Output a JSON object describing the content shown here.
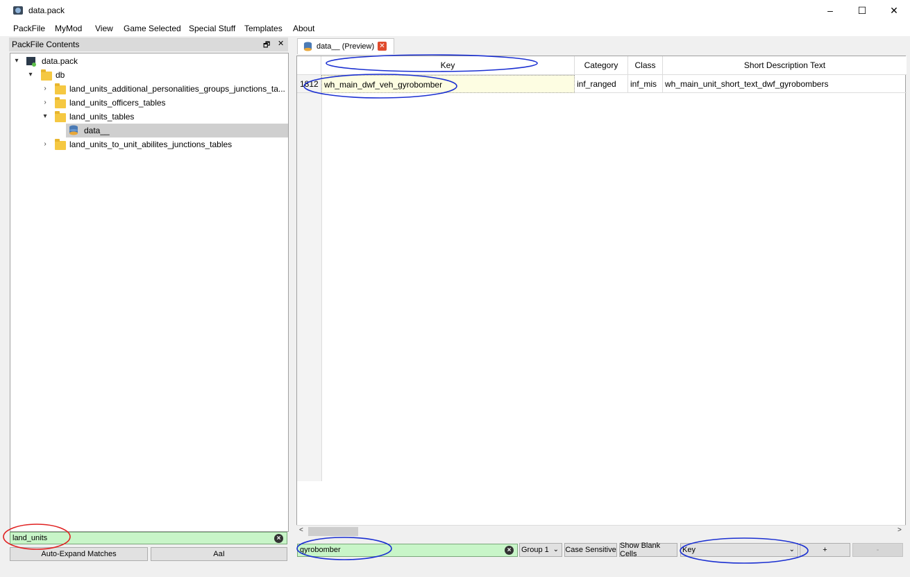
{
  "window": {
    "title": "data.pack",
    "minimize": "–",
    "maximize": "☐",
    "close": "✕"
  },
  "menu": {
    "items": [
      "PackFile",
      "MyMod",
      "View",
      "Game Selected",
      "Special Stuff",
      "Templates",
      "About"
    ]
  },
  "packfile_panel": {
    "title": "PackFile Contents",
    "float_icon": "🗗",
    "close_icon": "✕",
    "tree": {
      "root": "data.pack",
      "db": "db",
      "items": [
        "land_units_additional_personalities_groups_junctions_ta...",
        "land_units_officers_tables",
        "land_units_tables",
        "data__",
        "land_units_to_unit_abilites_junctions_tables"
      ]
    },
    "filter_value": "land_units",
    "auto_expand_label": "Auto-Expand Matches",
    "case_label": "AaI"
  },
  "tab": {
    "label": "data__ (Preview)",
    "close": "✕"
  },
  "table": {
    "columns": [
      "Key",
      "Category",
      "Class",
      "Short Description Text"
    ],
    "rows": [
      {
        "row_number": "1812",
        "key": "wh_main_dwf_veh_gyrobomber",
        "category": "inf_ranged",
        "class": "inf_mis",
        "short_description": "wh_main_unit_short_text_dwf_gyrobombers"
      }
    ]
  },
  "search_bar": {
    "value": "gyrobomber",
    "group": "Group 1",
    "case_sensitive": "Case Sensitive",
    "show_blank": "Show Blank Cells",
    "column": "Key",
    "add": "+",
    "remove": "-"
  },
  "scroll": {
    "left": "<",
    "right": ">"
  },
  "colors": {
    "filter_bg": "#c8f5c8",
    "annotation_blue": "#1a2fd1",
    "annotation_red": "#e02020",
    "key_cell_bg": "#fdfde2"
  }
}
